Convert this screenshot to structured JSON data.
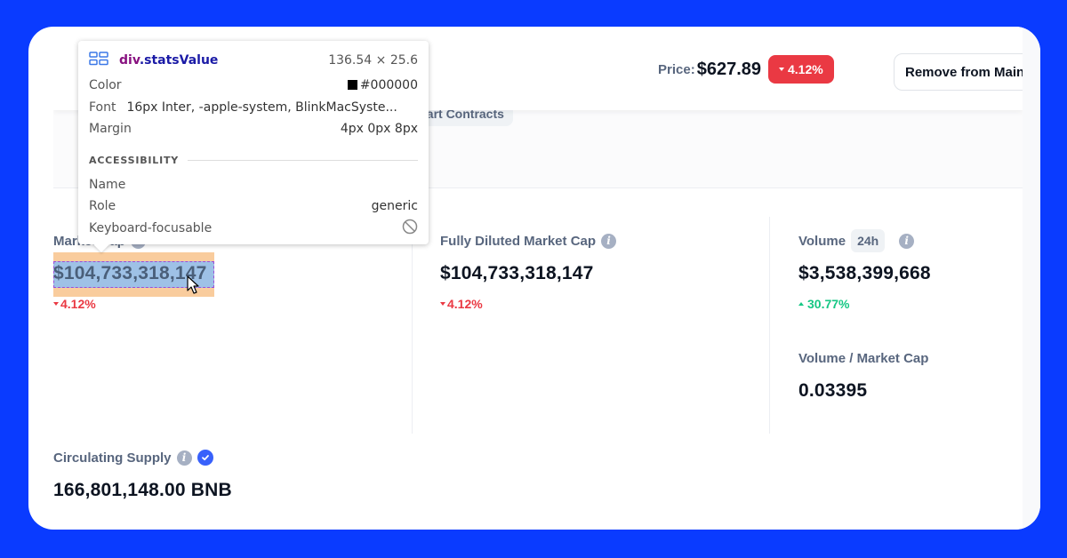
{
  "header": {
    "price_label": "Price:",
    "price_value": "$627.89",
    "price_change": "4.12%",
    "price_change_direction": "down",
    "remove_button_label": "Remove from Main"
  },
  "tags": [
    {
      "label": "Smart Contracts"
    }
  ],
  "stats": {
    "market_cap": {
      "label": "Market Cap",
      "value": "$104,733,318,147",
      "change": "4.12%",
      "direction": "down"
    },
    "fully_diluted": {
      "label": "Fully Diluted Market Cap",
      "value": "$104,733,318,147",
      "change": "4.12%",
      "direction": "down"
    },
    "volume": {
      "label": "Volume",
      "period": "24h",
      "value": "$3,538,399,668",
      "change": "30.77%",
      "direction": "up"
    },
    "volume_market_cap": {
      "label": "Volume / Market Cap",
      "value": "0.03395"
    },
    "circulating_supply": {
      "label": "Circulating Supply",
      "value": "166,801,148.00 BNB"
    }
  },
  "inspector": {
    "element_tag": "div",
    "element_class": ".statsValue",
    "size": "136.54 × 25.6",
    "rows": {
      "color_key": "Color",
      "color_value": "#000000",
      "font_key": "Font",
      "font_value": "16px Inter, -apple-system, BlinkMacSyste...",
      "margin_key": "Margin",
      "margin_value": "4px 0px 8px"
    },
    "accessibility": {
      "section_title": "ACCESSIBILITY",
      "name_key": "Name",
      "name_value": "",
      "role_key": "Role",
      "role_value": "generic",
      "focusable_key": "Keyboard-focusable"
    }
  },
  "colors": {
    "background": "#0a3bff",
    "negative": "#ea3943",
    "positive": "#16c784",
    "verified": "#3861fb"
  }
}
